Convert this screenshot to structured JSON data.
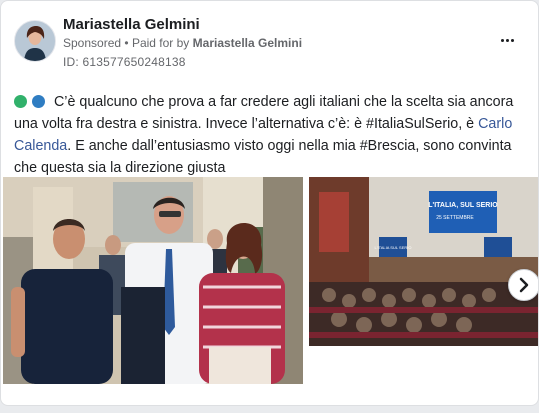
{
  "post": {
    "author": "Mariastella Gelmini",
    "sponsored": "Sponsored",
    "separator": "•",
    "paid_for_prefix": "Paid for by",
    "paid_for_name": "Mariastella Gelmini",
    "ad_id": "ID: 613577650248138",
    "body_part1": "C’è qualcuno che prova a far credere agli italiani che la scelta sia ancora una volta fra destra e sinistra. Invece l’alternativa c’è: è #ItaliaSulSerio, è ",
    "body_link": "Carlo Calenda",
    "body_part2": ". E anche dall’entusiasmo visto oggi nella mia #Brescia, sono convinta che questa sia la direzione giusta"
  },
  "icons": {
    "menu": "more-horizontal-icon",
    "emoji_1": "green-circle-icon",
    "emoji_2": "blue-circle-icon",
    "next": "chevron-right-icon"
  },
  "colors": {
    "green": "#31b16b",
    "blue": "#2f7dc2",
    "link": "#385898"
  },
  "images": {
    "stage_banner_line1": "L'ITALIA, SUL SERIO",
    "stage_banner_line2": "25 SETTEMBRE",
    "stage_banner_short": "L'ITALIA SUL SERIO"
  }
}
